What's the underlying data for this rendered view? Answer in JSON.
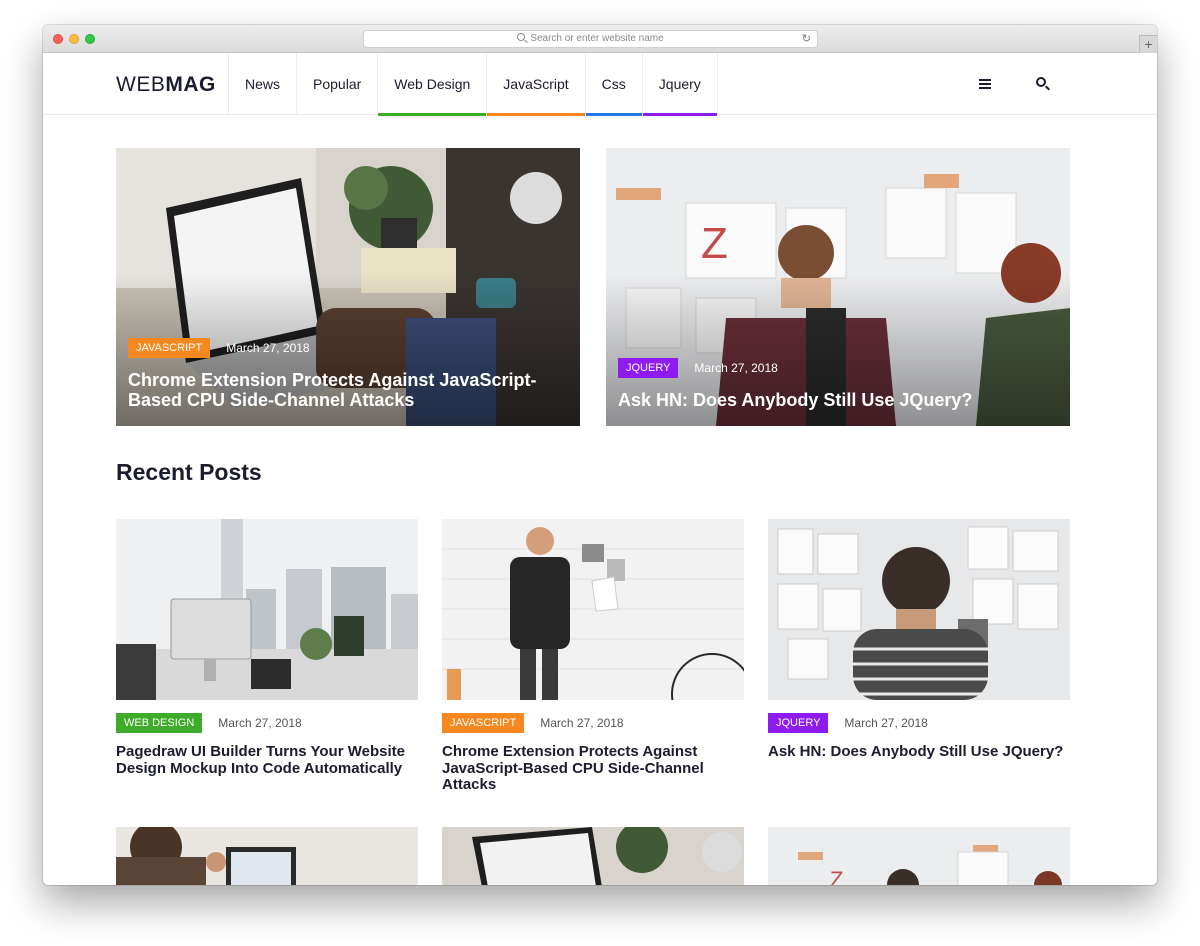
{
  "browser": {
    "url_placeholder": "Search or enter website name",
    "reload_icon": "reload-icon",
    "new_tab_label": "+"
  },
  "colors": {
    "javascript": "#f7871f",
    "jquery": "#8e1bf0",
    "web_design": "#3fab2b",
    "css": "#2678e6",
    "text_dark": "#1b1c2e"
  },
  "header": {
    "logo_light": "WEB",
    "logo_bold": "MAG",
    "nav": [
      {
        "label": "News",
        "underline": ""
      },
      {
        "label": "Popular",
        "underline": ""
      },
      {
        "label": "Web Design",
        "underline": "#3fab2b"
      },
      {
        "label": "JavaScript",
        "underline": "#f7871f"
      },
      {
        "label": "Css",
        "underline": "#2678e6"
      },
      {
        "label": "Jquery",
        "underline": "#8e1bf0"
      }
    ],
    "menu_icon": "hamburger-icon",
    "search_icon": "search-icon"
  },
  "featured": [
    {
      "category": "JAVASCRIPT",
      "date": "March 27, 2018",
      "title": "Chrome Extension Protects Against JavaScript-Based CPU Side-Channel Attacks"
    },
    {
      "category": "JQUERY",
      "date": "March 27, 2018",
      "title": "Ask HN: Does Anybody Still Use JQuery?"
    }
  ],
  "recent": {
    "title": "Recent Posts",
    "posts": [
      {
        "category": "WEB DESIGN",
        "date": "March 27, 2018",
        "title": "Pagedraw UI Builder Turns Your Website Design Mockup Into Code Automatically"
      },
      {
        "category": "JAVASCRIPT",
        "date": "March 27, 2018",
        "title": "Chrome Extension Protects Against JavaScript-Based CPU Side-Channel Attacks"
      },
      {
        "category": "JQUERY",
        "date": "March 27, 2018",
        "title": "Ask HN: Does Anybody Still Use JQuery?"
      }
    ]
  }
}
